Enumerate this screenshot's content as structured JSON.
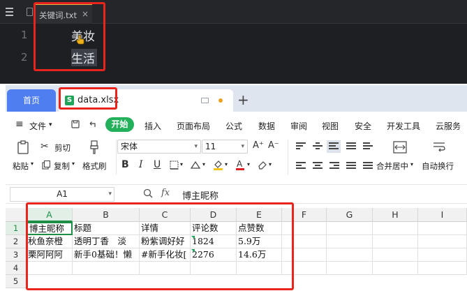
{
  "editor": {
    "tab_name": "关键词.txt",
    "close_glyph": "×",
    "line_numbers": [
      "1",
      "2"
    ],
    "lines": [
      "美妆",
      "生活"
    ]
  },
  "wps": {
    "home_tab": "首页",
    "file_tab": {
      "badge": "S",
      "name": "data.xlsx"
    },
    "new_tab_glyph": "+",
    "menu": {
      "hamburger": "≡",
      "file": "文件",
      "file_caret": "▾",
      "start": "开始",
      "items": [
        "插入",
        "页面布局",
        "公式",
        "数据",
        "审阅",
        "视图",
        "安全",
        "开发工具",
        "云服务"
      ]
    },
    "ribbon": {
      "paste": "粘贴",
      "cut": "剪切",
      "copy": "复制",
      "format_painter": "格式刷",
      "font_name": "宋体",
      "font_size": "11",
      "bold": "B",
      "italic": "I",
      "underline": "U",
      "merge_center": "合并居中",
      "wrap_text": "自动换行"
    },
    "formula_bar": {
      "cell_ref": "A1",
      "fx": "fx",
      "value": "博主昵称"
    },
    "grid": {
      "columns": [
        "A",
        "B",
        "C",
        "D",
        "E",
        "F",
        "G",
        "H",
        "I"
      ],
      "rows": [
        "1",
        "2",
        "3",
        "4",
        "5"
      ],
      "cells": [
        [
          "博主昵称",
          "标题",
          "详情",
          "评论数",
          "点赞数"
        ],
        [
          "秋鱼奈橙",
          "透明丁香　淡",
          "粉紫调好好",
          "1824",
          "5.9万"
        ],
        [
          "栗阿阿阿",
          "新手0基础！懒",
          "#新手化妆[",
          "2276",
          "14.6万"
        ]
      ]
    },
    "colors": {
      "accent_green": "#1fa55a",
      "home_tab_blue": "#4e7eef",
      "annotation_red": "#e8241c"
    }
  }
}
